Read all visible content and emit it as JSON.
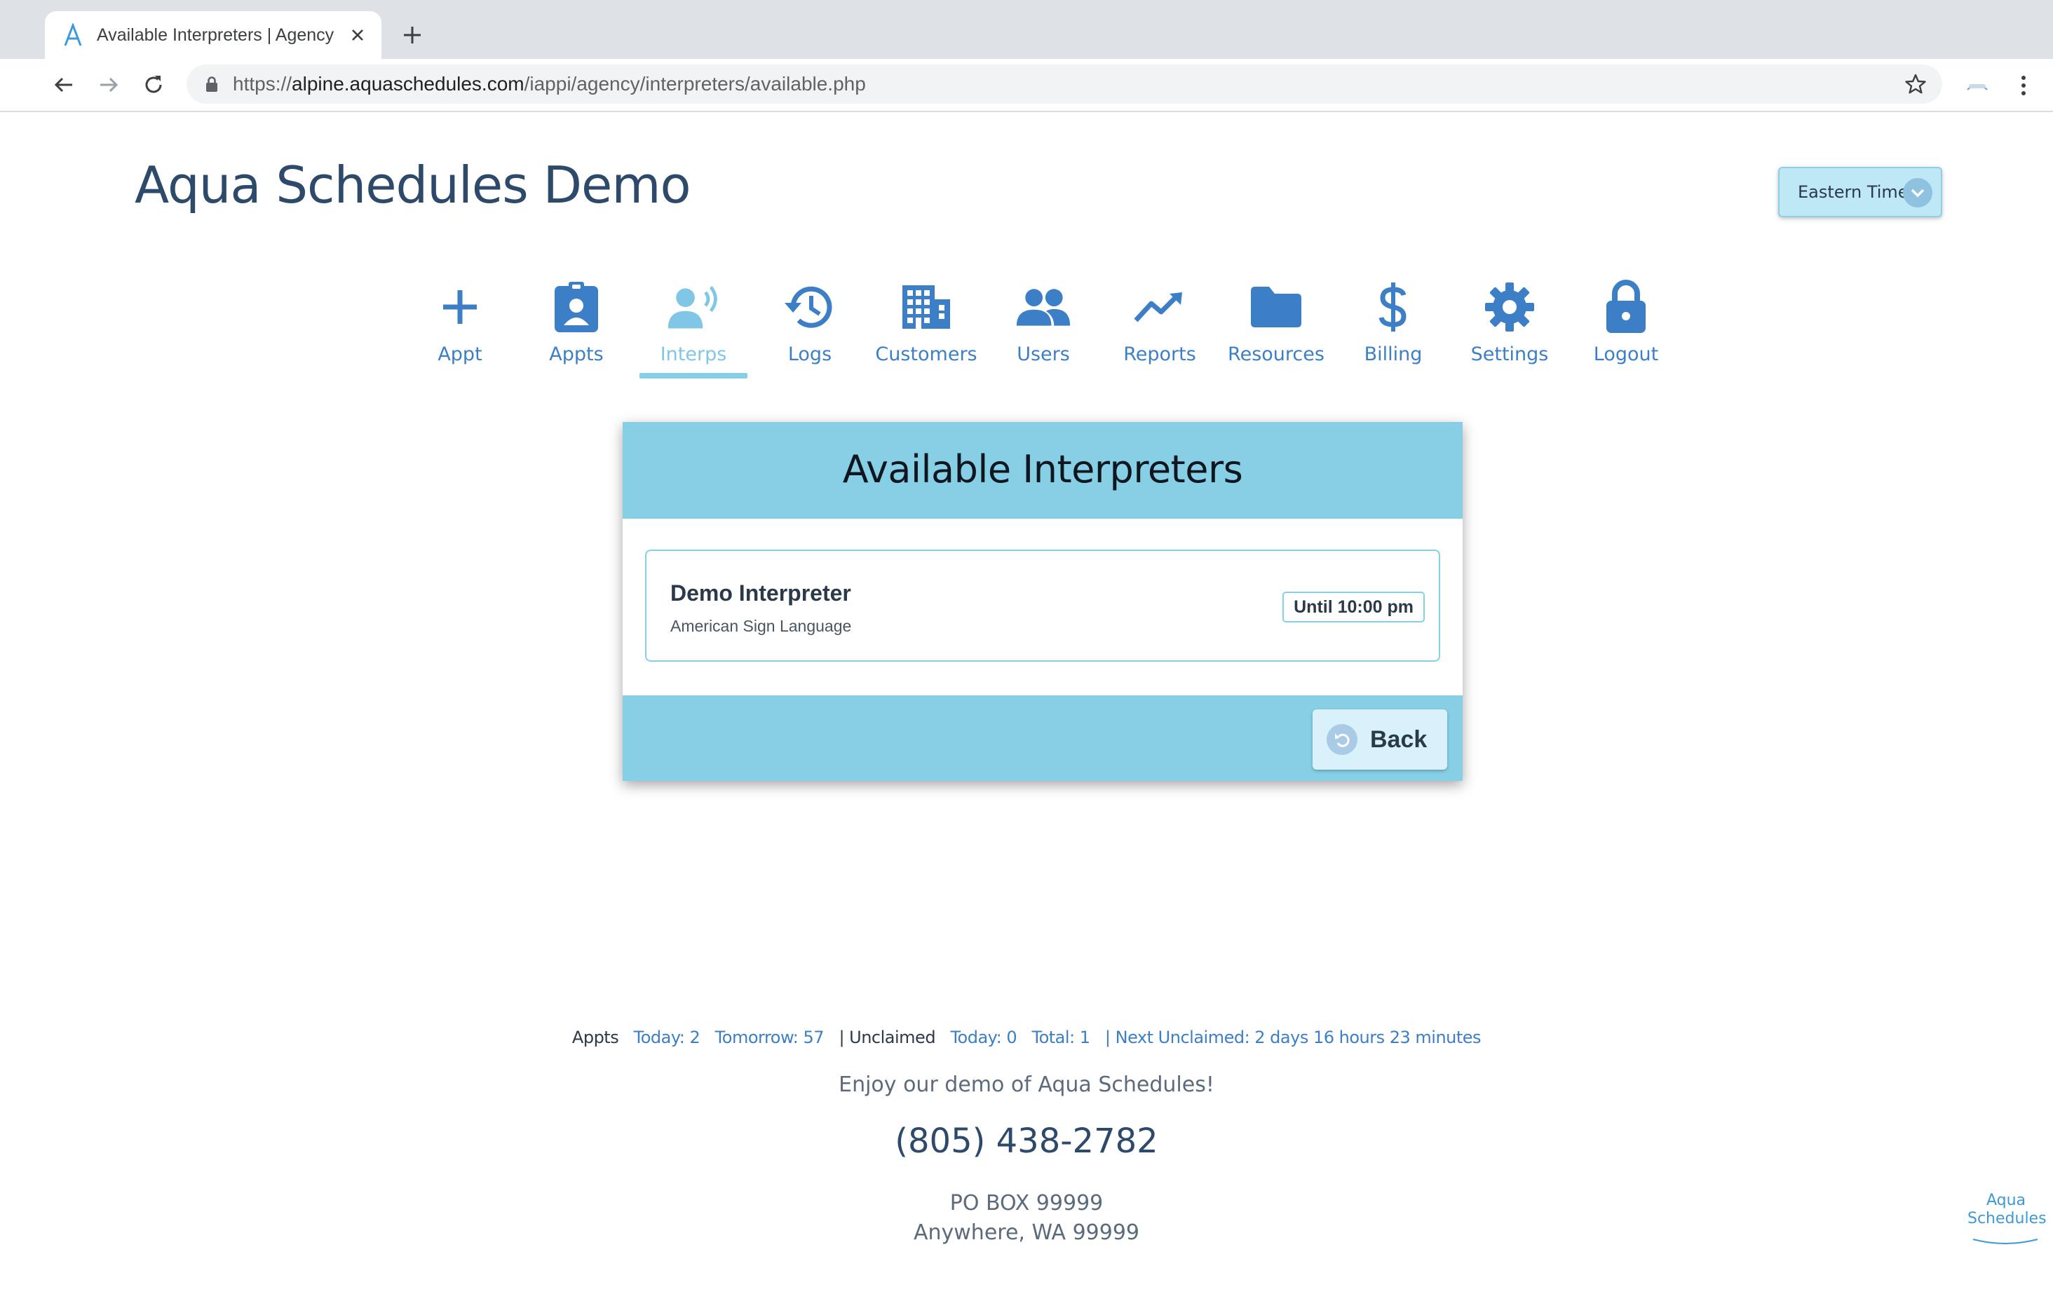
{
  "browser": {
    "tab_title": "Available Interpreters | Agency",
    "url_scheme": "https://",
    "url_host": "alpine.aquaschedules.com",
    "url_path": "/iappi/agency/interpreters/available.php"
  },
  "header": {
    "title": "Aqua Schedules Demo",
    "timezone": "Eastern Time"
  },
  "nav": {
    "items": [
      {
        "label": "Appt",
        "icon": "plus-icon"
      },
      {
        "label": "Appts",
        "icon": "badge-icon"
      },
      {
        "label": "Interps",
        "icon": "interpreter-icon",
        "active": true
      },
      {
        "label": "Logs",
        "icon": "history-icon"
      },
      {
        "label": "Customers",
        "icon": "building-icon"
      },
      {
        "label": "Users",
        "icon": "users-icon"
      },
      {
        "label": "Reports",
        "icon": "chart-line-icon"
      },
      {
        "label": "Resources",
        "icon": "folder-icon"
      },
      {
        "label": "Billing",
        "icon": "dollar-icon"
      },
      {
        "label": "Settings",
        "icon": "gear-icon"
      },
      {
        "label": "Logout",
        "icon": "lock-icon"
      }
    ]
  },
  "panel": {
    "title": "Available Interpreters",
    "interpreter": {
      "name": "Demo Interpreter",
      "language": "American Sign Language",
      "availability": "Until 10:00 pm"
    },
    "back_label": "Back"
  },
  "footer": {
    "appts_label": "Appts",
    "appts_today": "Today: 2",
    "appts_tomorrow": "Tomorrow: 57",
    "unclaimed_label": "| Unclaimed",
    "unclaimed_today": "Today: 0",
    "unclaimed_total": "Total: 1",
    "next_unclaimed": "| Next Unclaimed: 2 days 16 hours 23 minutes",
    "tagline": "Enjoy our demo of Aqua Schedules!",
    "phone": "(805) 438-2782",
    "address_line1": "PO BOX 99999",
    "address_line2": "Anywhere, WA 99999",
    "logo_line1": "Aqua",
    "logo_line2": "Schedules"
  },
  "colors": {
    "accent": "#3d7fc7",
    "panel_blue": "#86cfe5",
    "active_nav": "#7fc7e4"
  }
}
